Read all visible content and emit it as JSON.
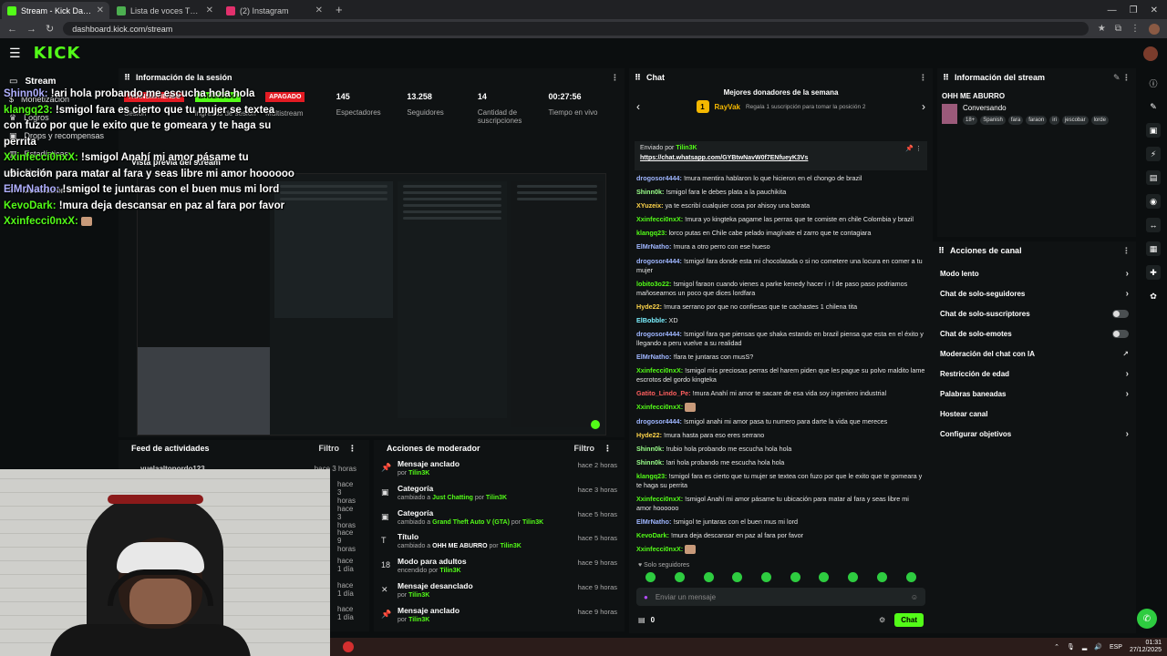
{
  "browser": {
    "tabs": [
      {
        "title": "Stream - Kick Dashboard",
        "color": "#53fc18"
      },
      {
        "title": "Lista de voces TTS de LordEmp",
        "color": "#4caf50"
      },
      {
        "title": "(2) Instagram",
        "color": "#e1306c"
      }
    ],
    "url": "dashboard.kick.com/stream"
  },
  "header": {
    "logo": "KICK"
  },
  "sidebar": {
    "items": [
      {
        "label": "Stream",
        "bold": true
      },
      {
        "label": "Monetización"
      },
      {
        "label": "Logros"
      },
      {
        "label": "Drops y recompensas"
      },
      {
        "label": "Estadísticas"
      },
      {
        "label": "Ajustes"
      },
      {
        "label": "Moderación"
      }
    ]
  },
  "overlay_chat": [
    {
      "user": "Shinn0k:",
      "text": "!ari hola probando me escucha hola hola",
      "cls": "gray"
    },
    {
      "user": "klangq23:",
      "text": "!smigol fara es cierto que tu mujer se textea con fuzo por que le exito que te gomeara y te haga su perrita",
      "cls": ""
    },
    {
      "user": "Xxinfecci0nxX:",
      "text": "!smigol Anahí mi amor pásame tu ubicación para matar al fara y seas libre mi amor hoooooo",
      "cls": ""
    },
    {
      "user": "ElMrNatho:",
      "text": "!smigol te juntaras con el buen mus mi lord",
      "cls": "gray"
    },
    {
      "user": "KevoDark:",
      "text": "!mura deja descansar en paz al fara por favor",
      "cls": ""
    },
    {
      "user": "Xxinfecci0nxX:",
      "text": "",
      "cls": ""
    }
  ],
  "session": {
    "title": "Información de la sesión",
    "stats": [
      {
        "value": "TRANSMITIENDO",
        "label": "Sesión",
        "badge": "red"
      },
      {
        "value": "ENCENDIDO",
        "label": "Ingresos de sesión",
        "badge": "green"
      },
      {
        "value": "APAGADO",
        "label": "Multistream",
        "badge": "red"
      },
      {
        "value": "145",
        "label": "Espectadores"
      },
      {
        "value": "13.258",
        "label": "Seguidores"
      },
      {
        "value": "14",
        "label": "Cantidad de suscripciones"
      },
      {
        "value": "00:27:56",
        "label": "Tiempo en vivo"
      }
    ]
  },
  "preview": {
    "title": "Vista previa del stream"
  },
  "feed": {
    "title": "Feed de actividades",
    "filter": "Filtro",
    "rows": [
      {
        "name": "vuelaaltopordo123",
        "time": "hace 3 horas"
      },
      {
        "name": "",
        "time": "hace 3 horas"
      },
      {
        "name": "",
        "time": "hace 3 horas"
      },
      {
        "name": "",
        "time": "hace 9 horas"
      },
      {
        "name": "",
        "time": "hace 1 día"
      },
      {
        "name": "",
        "time": "hace 1 día"
      },
      {
        "name": "",
        "time": "hace 1 día"
      }
    ]
  },
  "mod": {
    "title": "Acciones de moderador",
    "filter": "Filtro",
    "rows": [
      {
        "icon": "📌",
        "title": "Mensaje anclado",
        "pre": "por",
        "target": "",
        "by": "Tilin3K",
        "time": "hace 2 horas"
      },
      {
        "icon": "▣",
        "title": "Categoría",
        "pre": "cambiado a",
        "target": "Just Chatting",
        "by": "Tilin3K",
        "time": "hace 3 horas"
      },
      {
        "icon": "▣",
        "title": "Categoría",
        "pre": "cambiado a",
        "target": "Grand Theft Auto V (GTA)",
        "by": "Tilin3K",
        "time": "hace 5 horas"
      },
      {
        "icon": "T",
        "title": "Título",
        "pre": "cambiado a",
        "target": "OHH ME ABURRO",
        "by": "Tilin3K",
        "time": "hace 5 horas"
      },
      {
        "icon": "18",
        "title": "Modo para adultos",
        "pre": "encendido",
        "target": "",
        "by": "Tilin3K",
        "time": "hace 9 horas"
      },
      {
        "icon": "✕",
        "title": "Mensaje desanclado",
        "pre": "por",
        "target": "",
        "by": "Tilin3K",
        "time": "hace 9 horas"
      },
      {
        "icon": "📌",
        "title": "Mensaje anclado",
        "pre": "por",
        "target": "",
        "by": "Tilin3K",
        "time": "hace 9 horas"
      }
    ]
  },
  "chat": {
    "title": "Chat",
    "donors_title": "Mejores donadores de la semana",
    "donor": {
      "rank": "1",
      "name": "RayVak"
    },
    "donor_note": "Regala 1 suscripción para tomar la posición 2",
    "pinned_by_label": "Enviado por",
    "pinned_by": "Tilin3K",
    "pinned_link": "https://chat.whatsapp.com/GYBtwNavW0f7ENfueyK3Vs",
    "messages": [
      {
        "user": "drogosor4444:",
        "text": "!mura mentira hablaron lo que hicieron en el chongo de brazil",
        "color": "#9fb6ff"
      },
      {
        "user": "Shinn0k:",
        "text": "!smigol fara le debes plata a la pauchikita",
        "color": "#9aff8a"
      },
      {
        "user": "XYuzeix:",
        "text": "ya te escribí cualquier cosa por ahisoy una barata",
        "color": "#ffd54a"
      },
      {
        "user": "Xxinfecci0nxX:",
        "text": "!mura yo kingteka pagame las perras que te comiste en chile Colombia y brazil",
        "color": "#53fc18"
      },
      {
        "user": "klangq23:",
        "text": "lorco putas en Chile cabe pelado imagínate el zarro que te contagiara",
        "color": "#53fc18"
      },
      {
        "user": "ElMrNatho:",
        "text": "!mura a otro perro con ese hueso",
        "color": "#9fb6ff"
      },
      {
        "user": "drogosor4444:",
        "text": "!smigol fara donde esta mi chocolatada o si no cometere una locura en comer a tu mujer",
        "color": "#9fb6ff"
      },
      {
        "user": "lobito3o22:",
        "text": "!smigol faraon cuando vienes a parke kenedy hacer i r l de paso paso podriamos mañosearnos un poco que dices lordfara",
        "color": "#53fc18"
      },
      {
        "user": "Hyde22:",
        "text": "!mura serrano por que no confiesas que te cachastes 1 chilena tita",
        "color": "#ffd54a"
      },
      {
        "user": "ElBobble:",
        "text": "XD",
        "color": "#7bf0ff"
      },
      {
        "user": "drogosor4444:",
        "text": "!smigol fara que piensas que shaka estando en brazil piensa que esta en el éxito y llegando a peru vuelve a su realidad",
        "color": "#9fb6ff"
      },
      {
        "user": "ElMrNatho:",
        "text": "!fara te juntaras con musS?",
        "color": "#9fb6ff"
      },
      {
        "user": "Xxinfecci0nxX:",
        "text": "!smigol mis preciosas perras del harem piden que les pague su polvo maldito lame escrotos del gordo kingteka",
        "color": "#53fc18"
      },
      {
        "user": "Gatito_Lindo_Pe:",
        "text": "!mura Anahí mi amor te sacare de esa vida soy ingeniero industrial",
        "color": "#ff5f5f"
      },
      {
        "user": "Xxinfecci0nxX:",
        "text": "",
        "color": "#53fc18",
        "emote": true
      },
      {
        "user": "drogosor4444:",
        "text": "!smigol anahi mi amor pasa tu numero para darte la vida que mereces",
        "color": "#9fb6ff"
      },
      {
        "user": "Hyde22:",
        "text": "!mura hasta para eso eres serrano",
        "color": "#ffd54a"
      },
      {
        "user": "Shinn0k:",
        "text": "!rubio hola probando me escucha hola hola",
        "color": "#9aff8a"
      },
      {
        "user": "Shinn0k:",
        "text": "!ari hola probando me escucha hola hola",
        "color": "#9aff8a"
      },
      {
        "user": "klangq23:",
        "text": "!smigol fara es cierto que tu mujer se textea con fuzo por que le exito que te gomeara y te haga su perrita",
        "color": "#53fc18"
      },
      {
        "user": "Xxinfecci0nxX:",
        "text": "!smigol Anahí mi amor pásame tu ubicación para matar al fara y seas libre mi amor hoooooo",
        "color": "#53fc18"
      },
      {
        "user": "ElMrNatho:",
        "text": "!smigol te juntaras con el buen mus mi lord",
        "color": "#9fb6ff"
      },
      {
        "user": "KevoDark:",
        "text": "!mura deja descansar en paz al fara por favor",
        "color": "#53fc18"
      },
      {
        "user": "Xxinfecci0nxX:",
        "text": "",
        "color": "#53fc18",
        "emote": true
      }
    ],
    "followers_only": "Solo seguidores",
    "input_placeholder": "Enviar un mensaje",
    "count": "0",
    "send_label": "Chat"
  },
  "stream_info": {
    "title": "Información del stream",
    "stream_title": "OHH ME ABURRO",
    "category": "Conversando",
    "tags": [
      "18+",
      "Spanish",
      "fara",
      "faraon",
      "iri",
      "jescobar",
      "lorde"
    ]
  },
  "channel_actions": {
    "title": "Acciones de canal",
    "items": [
      {
        "label": "Modo lento",
        "type": "arrow"
      },
      {
        "label": "Chat de solo-seguidores",
        "type": "arrow"
      },
      {
        "label": "Chat de solo-suscriptores",
        "type": "toggle"
      },
      {
        "label": "Chat de solo-emotes",
        "type": "toggle"
      },
      {
        "label": "Moderación del chat con IA",
        "type": "external"
      },
      {
        "label": "Restricción de edad",
        "type": "arrow"
      },
      {
        "label": "Palabras baneadas",
        "type": "arrow"
      },
      {
        "label": "Hostear canal",
        "type": "none"
      },
      {
        "label": "Configurar objetivos",
        "type": "arrow"
      }
    ]
  },
  "taskbar": {
    "lang": "ESP",
    "time": "01:31",
    "date": "27/12/2025"
  }
}
